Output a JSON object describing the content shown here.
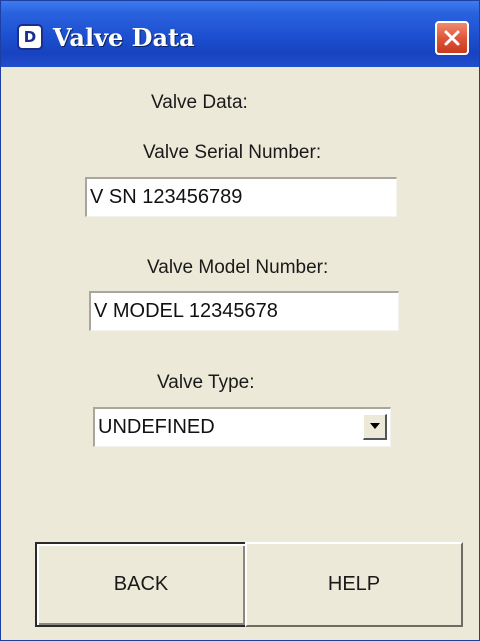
{
  "window": {
    "title": "Valve Data",
    "app_icon_letter": "D"
  },
  "form": {
    "heading": "Valve Data:",
    "serial_label": "Valve Serial Number:",
    "serial_value": "V SN 123456789",
    "model_label": "Valve Model Number:",
    "model_value": "V MODEL 12345678",
    "type_label": "Valve Type:",
    "type_value": "UNDEFINED"
  },
  "buttons": {
    "back_label": "BACK",
    "help_label": "HELP"
  },
  "icons": {
    "app": "app-d-icon",
    "close": "close-icon",
    "dropdown": "chevron-down-icon"
  },
  "colors": {
    "titlebar": "#1c4fd0",
    "close_button": "#e0563a",
    "window_background": "#ece9d8"
  }
}
